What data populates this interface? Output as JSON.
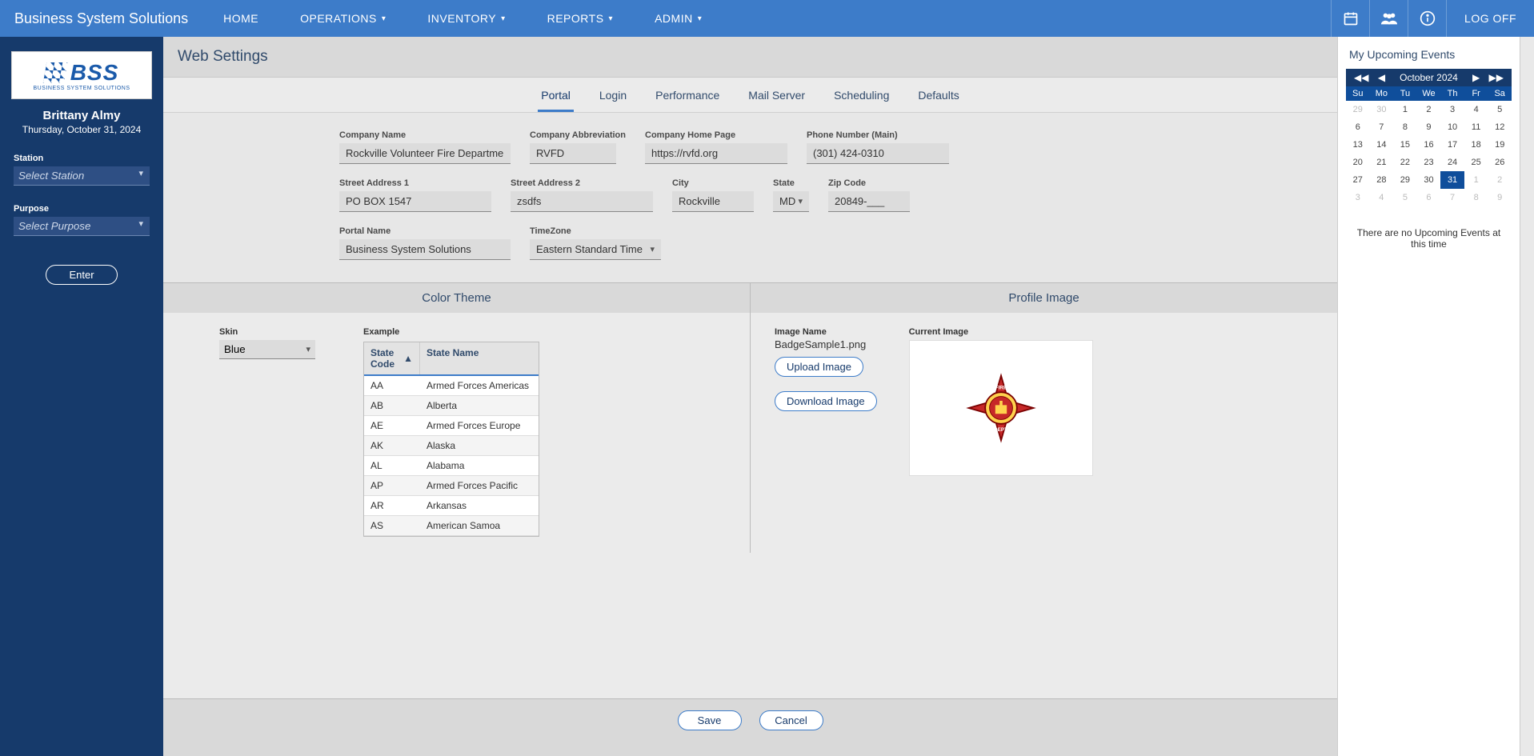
{
  "brand": "Business System Solutions",
  "nav": {
    "home": "HOME",
    "operations": "OPERATIONS",
    "inventory": "INVENTORY",
    "reports": "REPORTS",
    "admin": "ADMIN",
    "logoff": "LOG OFF"
  },
  "sidebar": {
    "logo_big": "BSS",
    "logo_small": "BUSINESS SYSTEM SOLUTIONS",
    "username": "Brittany Almy",
    "date": "Thursday, October 31, 2024",
    "station_label": "Station",
    "station_placeholder": "Select Station",
    "purpose_label": "Purpose",
    "purpose_placeholder": "Select Purpose",
    "enter": "Enter"
  },
  "page_title": "Web Settings",
  "tabs": {
    "portal": "Portal",
    "login": "Login",
    "performance": "Performance",
    "mail": "Mail Server",
    "scheduling": "Scheduling",
    "defaults": "Defaults"
  },
  "form": {
    "company_name_label": "Company Name",
    "company_name": "Rockville Volunteer Fire Department",
    "abbrev_label": "Company Abbreviation",
    "abbrev": "RVFD",
    "homepage_label": "Company Home Page",
    "homepage": "https://rvfd.org",
    "phone_label": "Phone Number (Main)",
    "phone": "(301) 424-0310",
    "addr1_label": "Street Address 1",
    "addr1": "PO BOX 1547",
    "addr2_label": "Street Address 2",
    "addr2": "zsdfs",
    "city_label": "City",
    "city": "Rockville",
    "state_label": "State",
    "state": "MD",
    "zip_label": "Zip Code",
    "zip": "20849-___",
    "portal_name_label": "Portal Name",
    "portal_name": "Business System Solutions",
    "tz_label": "TimeZone",
    "tz": "Eastern Standard Time"
  },
  "color_section_title": "Color Theme",
  "profile_section_title": "Profile Image",
  "skin": {
    "label": "Skin",
    "value": "Blue",
    "example_label": "Example",
    "col_code": "State Code",
    "col_name": "State Name",
    "rows": [
      {
        "code": "AA",
        "name": "Armed Forces Americas"
      },
      {
        "code": "AB",
        "name": "Alberta"
      },
      {
        "code": "AE",
        "name": "Armed Forces Europe"
      },
      {
        "code": "AK",
        "name": "Alaska"
      },
      {
        "code": "AL",
        "name": "Alabama"
      },
      {
        "code": "AP",
        "name": "Armed Forces Pacific"
      },
      {
        "code": "AR",
        "name": "Arkansas"
      },
      {
        "code": "AS",
        "name": "American Samoa"
      }
    ]
  },
  "profile": {
    "image_name_label": "Image Name",
    "image_name": "BadgeSample1.png",
    "upload": "Upload Image",
    "download": "Download Image",
    "current_label": "Current Image"
  },
  "footer": {
    "save": "Save",
    "cancel": "Cancel"
  },
  "rightpanel": {
    "title": "My Upcoming Events",
    "month": "October 2024",
    "dow": [
      "Su",
      "Mo",
      "Tu",
      "We",
      "Th",
      "Fr",
      "Sa"
    ],
    "weeks": [
      [
        {
          "d": "29",
          "m": true
        },
        {
          "d": "30",
          "m": true
        },
        {
          "d": "1"
        },
        {
          "d": "2"
        },
        {
          "d": "3"
        },
        {
          "d": "4"
        },
        {
          "d": "5"
        }
      ],
      [
        {
          "d": "6"
        },
        {
          "d": "7"
        },
        {
          "d": "8"
        },
        {
          "d": "9"
        },
        {
          "d": "10"
        },
        {
          "d": "11"
        },
        {
          "d": "12"
        }
      ],
      [
        {
          "d": "13"
        },
        {
          "d": "14"
        },
        {
          "d": "15"
        },
        {
          "d": "16"
        },
        {
          "d": "17"
        },
        {
          "d": "18"
        },
        {
          "d": "19"
        }
      ],
      [
        {
          "d": "20"
        },
        {
          "d": "21"
        },
        {
          "d": "22"
        },
        {
          "d": "23"
        },
        {
          "d": "24"
        },
        {
          "d": "25"
        },
        {
          "d": "26"
        }
      ],
      [
        {
          "d": "27"
        },
        {
          "d": "28"
        },
        {
          "d": "29"
        },
        {
          "d": "30"
        },
        {
          "d": "31",
          "today": true
        },
        {
          "d": "1",
          "m": true
        },
        {
          "d": "2",
          "m": true
        }
      ],
      [
        {
          "d": "3",
          "m": true
        },
        {
          "d": "4",
          "m": true
        },
        {
          "d": "5",
          "m": true
        },
        {
          "d": "6",
          "m": true
        },
        {
          "d": "7",
          "m": true
        },
        {
          "d": "8",
          "m": true
        },
        {
          "d": "9",
          "m": true
        }
      ]
    ],
    "no_events": "There are no Upcoming Events at this time"
  }
}
